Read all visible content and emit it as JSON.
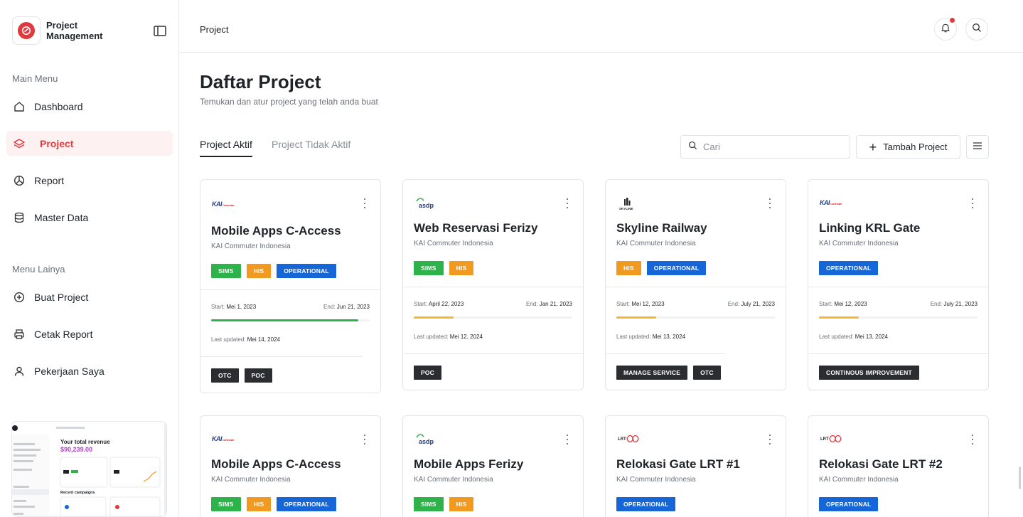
{
  "sidebar": {
    "brand": "Project Management",
    "sections": {
      "main": "Main Menu",
      "other": "Menu Lainya"
    },
    "main_items": [
      {
        "label": "Dashboard",
        "icon": "home-icon"
      },
      {
        "label": "Project",
        "icon": "layers-icon",
        "active": true
      },
      {
        "label": "Report",
        "icon": "pie-chart-icon"
      },
      {
        "label": "Master Data",
        "icon": "database-icon"
      }
    ],
    "other_items": [
      {
        "label": "Buat Project",
        "icon": "plus-circle-icon"
      },
      {
        "label": "Cetak Report",
        "icon": "printer-icon"
      },
      {
        "label": "Pekerjaan Saya",
        "icon": "user-icon"
      }
    ],
    "promo": {
      "headline": "Your total revenue",
      "amount": "$90,239.00",
      "recent": "Recent campaigns"
    }
  },
  "header": {
    "breadcrumb": "Project"
  },
  "page": {
    "title": "Daftar Project",
    "subtitle": "Temukan dan atur project yang telah anda buat",
    "tabs": [
      "Project Aktif",
      "Project Tidak Aktif"
    ],
    "search_placeholder": "Cari",
    "add_label": "Tambah Project"
  },
  "labels": {
    "start": "Start:",
    "end": "End:",
    "updated": "Last updated:"
  },
  "colors": {
    "accent": "#e0393e",
    "progress_green": "#2db34a",
    "progress_yellow": "#f5b731"
  },
  "cards": [
    {
      "logo": "KAI",
      "title": "Mobile Apps C-Access",
      "client": "KAI Commuter Indonesia",
      "tags": [
        "SIMS",
        "HIS",
        "OPERATIONAL"
      ],
      "start": "Mei 1, 2023",
      "end": "Jun 21, 2023",
      "progress": 0.93,
      "updated": "Mei 14, 2024",
      "bottom_tags": [
        "OTC",
        "POC"
      ]
    },
    {
      "logo": "asdp",
      "title": "Web Reservasi Ferizy",
      "client": "KAI Commuter Indonesia",
      "tags": [
        "SIMS",
        "HIS"
      ],
      "start": "April 22, 2023",
      "end": "Jan 21, 2023",
      "progress": 0.25,
      "updated": "Mei 12, 2024",
      "bottom_tags": [
        "POC"
      ]
    },
    {
      "logo": "SKYLINE",
      "title": "Skyline Railway",
      "client": "KAI Commuter Indonesia",
      "tags": [
        "HIS",
        "OPERATIONAL"
      ],
      "start": "Mei 12, 2023",
      "end": "July 21, 2023",
      "progress": 0.25,
      "updated": "Mei 13, 2024",
      "bottom_tags": [
        "MANAGE SERVICE",
        "OTC"
      ]
    },
    {
      "logo": "KAI",
      "title": "Linking KRL Gate",
      "client": "KAI Commuter Indonesia",
      "tags": [
        "OPERATIONAL"
      ],
      "start": "Mei 12, 2023",
      "end": "July 21, 2023",
      "progress": 0.25,
      "updated": "Mei 13, 2024",
      "bottom_tags": [
        "CONTINOUS IMPROVEMENT"
      ]
    },
    {
      "logo": "KAI",
      "title": "Mobile Apps C-Access",
      "client": "KAI Commuter Indonesia",
      "tags": [
        "SIMS",
        "HIS",
        "OPERATIONAL"
      ]
    },
    {
      "logo": "asdp",
      "title": "Mobile Apps Ferizy",
      "client": "KAI Commuter Indonesia",
      "tags": [
        "SIMS",
        "HIS"
      ]
    },
    {
      "logo": "LRT",
      "title": "Relokasi Gate LRT #1",
      "client": "KAI Commuter Indonesia",
      "tags": [
        "OPERATIONAL"
      ]
    },
    {
      "logo": "LRT",
      "title": "Relokasi Gate LRT #2",
      "client": "KAI Commuter Indonesia",
      "tags": [
        "OPERATIONAL"
      ]
    }
  ]
}
